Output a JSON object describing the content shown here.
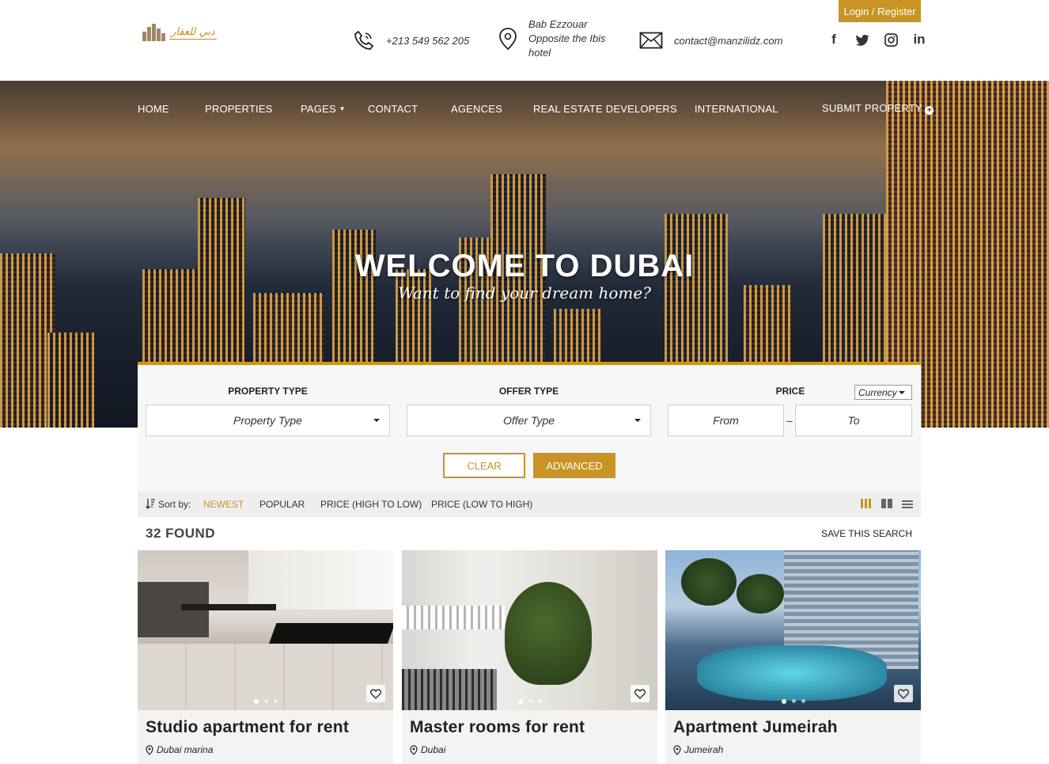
{
  "header": {
    "logo_text": "دبي للعقار",
    "phone": "+213 549 562 205",
    "address": [
      "Bab Ezzouar",
      "Opposite the Ibis",
      "hotel"
    ],
    "email": "contact@manzilidz.com",
    "login_label": "Login / Register",
    "social": [
      "facebook-icon",
      "twitter-icon",
      "instagram-icon",
      "linkedin-icon"
    ]
  },
  "nav": {
    "items": [
      "HOME",
      "PROPERTIES",
      "PAGES",
      "CONTACT",
      "AGENCES",
      "REAL ESTATE DEVELOPERS",
      "INTERNATIONAL",
      "SUBMIT PROPERTY"
    ]
  },
  "hero": {
    "title": "WELCOME TO DUBAI",
    "subtitle": "Want to find your dream home?"
  },
  "search": {
    "property_type_label": "PROPERTY TYPE",
    "property_type_value": "Property Type",
    "offer_type_label": "OFFER TYPE",
    "offer_type_value": "Offer Type",
    "price_label": "PRICE",
    "currency_value": "Currency",
    "from_placeholder": "From",
    "to_placeholder": "To",
    "dash": "–",
    "clear_label": "CLEAR",
    "advanced_label": "ADVANCED"
  },
  "sort": {
    "label": "Sort by:",
    "options": [
      "NEWEST",
      "POPULAR",
      "PRICE (HIGH TO LOW)",
      "PRICE (LOW TO HIGH)"
    ],
    "active": "NEWEST"
  },
  "results": {
    "found": "32 FOUND",
    "save_label": "SAVE THIS SEARCH"
  },
  "listings": [
    {
      "title": "Studio apartment for rent",
      "location": "Dubai marina"
    },
    {
      "title": "Master rooms for rent",
      "location": "Dubai"
    },
    {
      "title": "Apartment Jumeirah",
      "location": "Jumeirah"
    }
  ],
  "colors": {
    "accent": "#c99423"
  }
}
